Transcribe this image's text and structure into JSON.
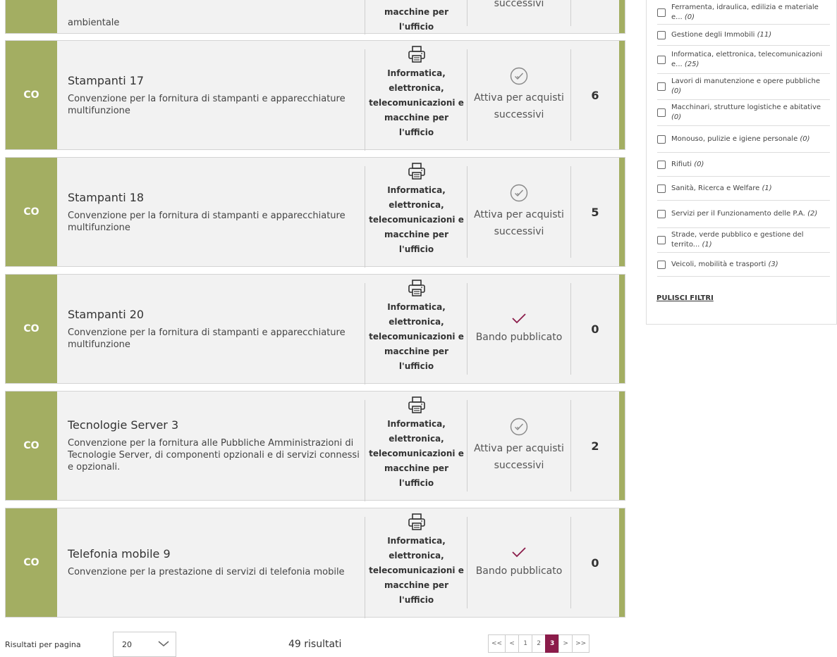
{
  "top_row": {
    "desc_fragment": "ambientale",
    "cat_fragment": [
      "macchine per",
      "l'ufficio"
    ],
    "status_fragment": "successivi"
  },
  "rows": [
    {
      "code": "CO",
      "title": "Stampanti 17",
      "desc": "Convenzione per la fornitura di stampanti e apparecchiature multifunzione",
      "category": [
        "Informatica,",
        "elettronica,",
        "telecomunicazioni e",
        "macchine per",
        "l'ufficio"
      ],
      "status_icon": "check-circle-icon",
      "status": [
        "Attiva per acquisti",
        "successivi"
      ],
      "count": "6"
    },
    {
      "code": "CO",
      "title": "Stampanti 18",
      "desc": "Convenzione per la fornitura di stampanti e apparecchiature multifunzione",
      "category": [
        "Informatica,",
        "elettronica,",
        "telecomunicazioni e",
        "macchine per",
        "l'ufficio"
      ],
      "status_icon": "check-circle-icon",
      "status": [
        "Attiva per acquisti",
        "successivi"
      ],
      "count": "5"
    },
    {
      "code": "CO",
      "title": "Stampanti 20",
      "desc": "Convenzione per la fornitura di stampanti e apparecchiature multifunzione",
      "category": [
        "Informatica,",
        "elettronica,",
        "telecomunicazioni e",
        "macchine per",
        "l'ufficio"
      ],
      "status_icon": "checkmark-icon",
      "status": [
        "Bando pubblicato"
      ],
      "count": "0"
    },
    {
      "code": "CO",
      "title": "Tecnologie Server 3",
      "desc": "Convenzione per la fornitura alle Pubbliche Amministrazioni di Tecnologie Server, di componenti opzionali e di servizi connessi e opzionali.",
      "category": [
        "Informatica,",
        "elettronica,",
        "telecomunicazioni e",
        "macchine per",
        "l'ufficio"
      ],
      "status_icon": "check-circle-icon",
      "status": [
        "Attiva per acquisti",
        "successivi"
      ],
      "count": "2"
    },
    {
      "code": "CO",
      "title": "Telefonia mobile 9",
      "desc": "Convenzione per la prestazione di servizi di telefonia mobile",
      "category": [
        "Informatica,",
        "elettronica,",
        "telecomunicazioni e",
        "macchine per",
        "l'ufficio"
      ],
      "status_icon": "checkmark-icon",
      "status": [
        "Bando pubblicato"
      ],
      "count": "0"
    }
  ],
  "filters": [
    {
      "label": "Ferramenta, idraulica, edilizia e materiale e...",
      "count": "(0)"
    },
    {
      "label": "Gestione degli Immobili",
      "count": "(11)"
    },
    {
      "label": "Informatica, elettronica, telecomunicazioni e...",
      "count": "(25)"
    },
    {
      "label": "Lavori di manutenzione e opere pubbliche",
      "count": "(0)"
    },
    {
      "label": "Macchinari, strutture logistiche e abitative",
      "count": "(0)"
    },
    {
      "label": "Monouso, pulizie e igiene personale",
      "count": "(0)"
    },
    {
      "label": "Rifiuti",
      "count": "(0)"
    },
    {
      "label": "Sanità, Ricerca e Welfare",
      "count": "(1)"
    },
    {
      "label": "Servizi per il Funzionamento delle P.A.",
      "count": "(2)"
    },
    {
      "label": "Strade, verde pubblico e gestione del territo...",
      "count": "(1)"
    },
    {
      "label": "Veicoli, mobilità e trasporti",
      "count": "(3)"
    }
  ],
  "clear_filters": "PULISCI FILTRI",
  "footer": {
    "per_page_label": "Risultati per pagina",
    "per_page_value": "20",
    "results": "49 risultati",
    "pages": [
      "<<",
      "<",
      "1",
      "2",
      "3",
      ">",
      ">>"
    ],
    "active_page": "3"
  },
  "colors": {
    "accent": "#a3ae62",
    "active_page": "#8b1c4a",
    "check": "#8b1c4a"
  }
}
